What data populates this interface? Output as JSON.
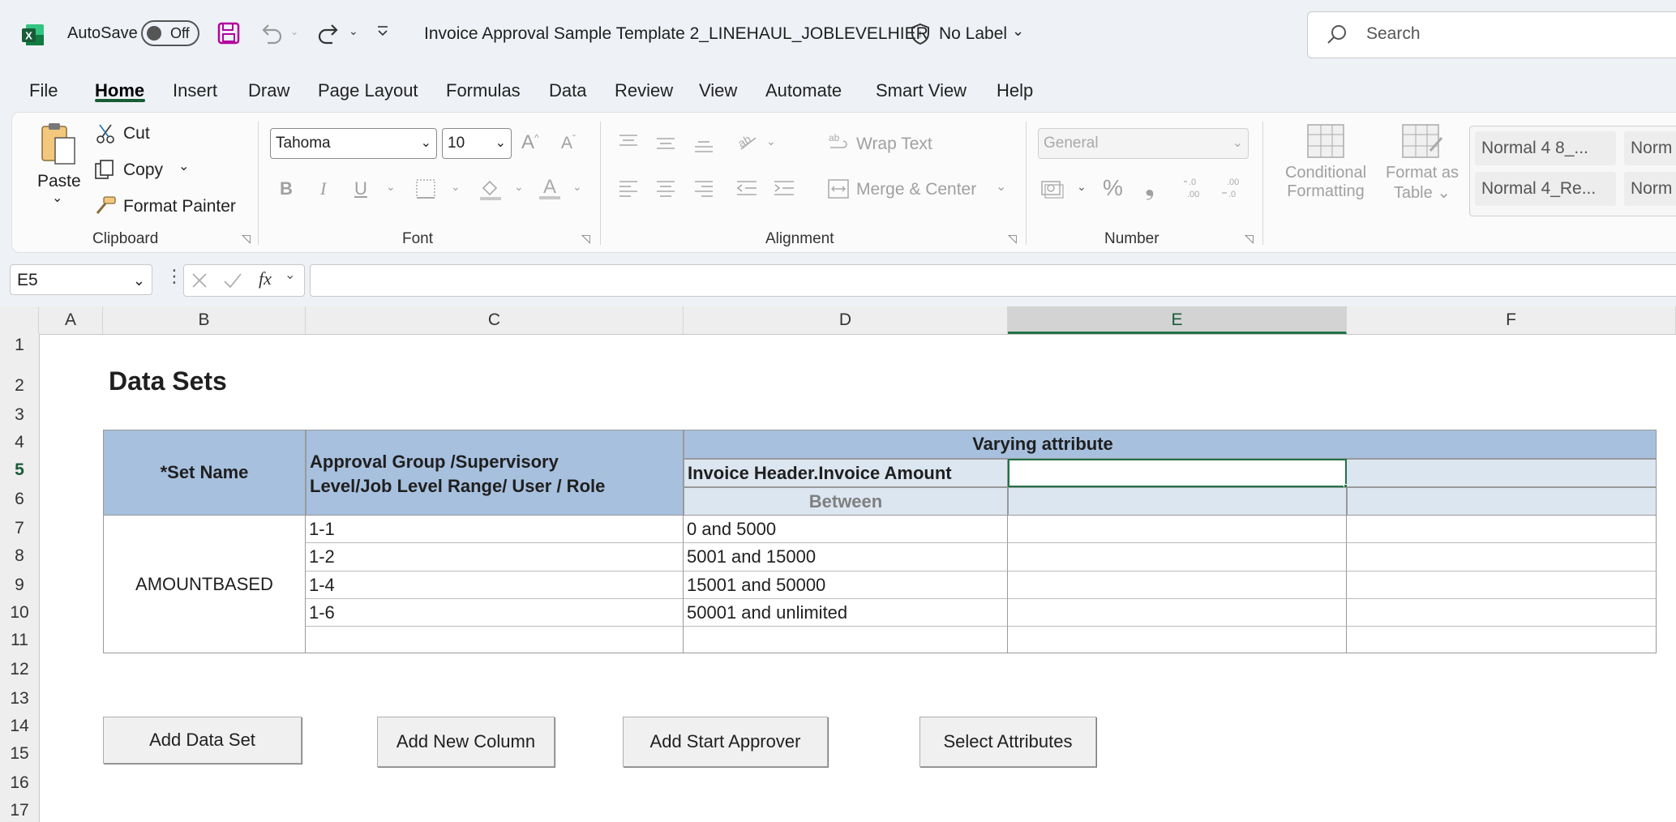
{
  "titlebar": {
    "autosave_label": "AutoSave",
    "autosave_state": "Off",
    "document_title": "Invoice Approval Sample Template 2_LINEHAUL_JOBLEVELHIER",
    "label_text": "No Label",
    "search_placeholder": "Search"
  },
  "menu": [
    "File",
    "Home",
    "Insert",
    "Draw",
    "Page Layout",
    "Formulas",
    "Data",
    "Review",
    "View",
    "Automate",
    "Smart View",
    "Help"
  ],
  "ribbon": {
    "clipboard": {
      "paste": "Paste",
      "cut": "Cut",
      "copy": "Copy",
      "format_painter": "Format Painter",
      "group_label": "Clipboard"
    },
    "font": {
      "font_name": "Tahoma",
      "font_size": "10",
      "bold": "B",
      "italic": "I",
      "underline": "U",
      "group_label": "Font"
    },
    "alignment": {
      "wrap_text": "Wrap Text",
      "merge_center": "Merge & Center",
      "group_label": "Alignment"
    },
    "number": {
      "format": "General",
      "percent": "%",
      "comma": "❟",
      "group_label": "Number"
    },
    "styles": {
      "conditional_formatting_1": "Conditional",
      "conditional_formatting_2": "Formatting",
      "format_as_table_1": "Format as",
      "format_as_table_2": "Table",
      "style1": "Normal 4 8_...",
      "style2": "Norm",
      "style3": "Normal 4_Re...",
      "style4": "Norm"
    }
  },
  "formula_bar": {
    "name_box": "E5",
    "fx": "fx",
    "value": ""
  },
  "columns": [
    "A",
    "B",
    "C",
    "D",
    "E",
    "F"
  ],
  "rows": [
    "1",
    "2",
    "3",
    "4",
    "5",
    "6",
    "7",
    "8",
    "9",
    "10",
    "11",
    "12",
    "13",
    "14",
    "15",
    "16",
    "17"
  ],
  "sheet": {
    "title": "Data Sets",
    "set_name_header": "*Set Name",
    "approval_header_line1": "Approval Group /Supervisory",
    "approval_header_line2": "Level/Job Level Range/ User / Role",
    "varying_attribute": "Varying attribute",
    "attribute_name": "Invoice Header.Invoice Amount",
    "operator": "Between",
    "set_name": "AMOUNTBASED",
    "data_rows": [
      {
        "level": "1-1",
        "range": "0 and 5000"
      },
      {
        "level": "1-2",
        "range": "5001 and 15000"
      },
      {
        "level": "1-4",
        "range": "15001 and 50000"
      },
      {
        "level": "1-6",
        "range": "50001 and unlimited"
      }
    ]
  },
  "buttons": {
    "add_data_set": "Add Data Set",
    "add_new_column": "Add New Column",
    "add_start_approver": "Add Start Approver",
    "select_attributes": "Select Attributes"
  },
  "colors": {
    "excel_green": "#217346",
    "header_blue": "#a7c0de",
    "light_blue": "#dce6f1"
  }
}
